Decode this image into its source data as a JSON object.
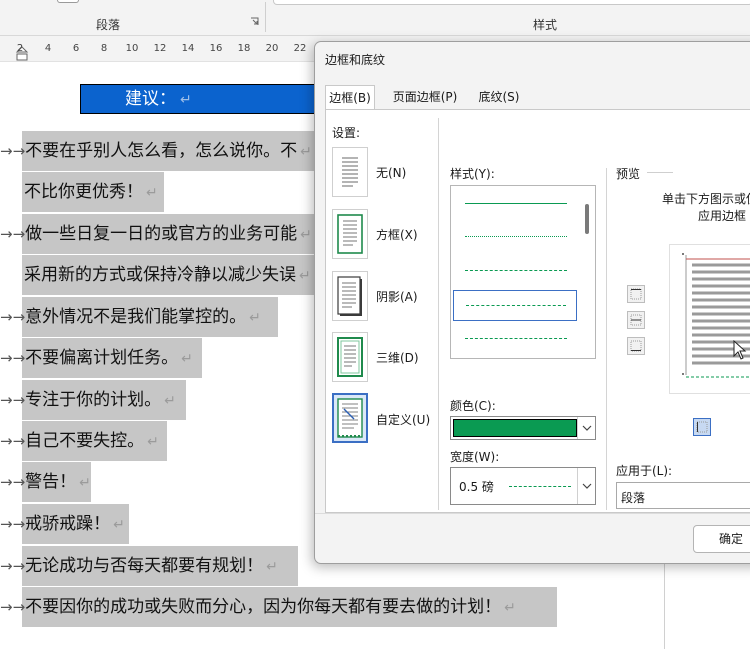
{
  "ribbon": {
    "paragraph_group": "段落",
    "styles_group": "样式"
  },
  "ruler": {
    "ticks": [
      "2",
      "4",
      "6",
      "8",
      "10",
      "12",
      "14",
      "16",
      "18",
      "20",
      "22"
    ]
  },
  "document": {
    "heading": "建议：",
    "mark": "↵",
    "bullet": "→→",
    "lines": [
      {
        "text": "不要在乎别人怎么看，怎么说你。不",
        "bullet": true
      },
      {
        "text": "不比你更优秀！",
        "bullet": false
      },
      {
        "text": "做一些日复一日的或官方的业务可能",
        "bullet": true
      },
      {
        "text": "采用新的方式或保持冷静以减少失误",
        "bullet": false
      },
      {
        "text": "意外情况不是我们能掌控的。",
        "bullet": true
      },
      {
        "text": "不要偏离计划任务。",
        "bullet": true
      },
      {
        "text": "专注于你的计划。",
        "bullet": true
      },
      {
        "text": "自己不要失控。",
        "bullet": true
      },
      {
        "text": "警告！",
        "bullet": true
      },
      {
        "text": "戒骄戒躁！",
        "bullet": true
      },
      {
        "text": "无论成功与否每天都要有规划！",
        "bullet": true
      },
      {
        "text": "不要因你的成功或失败而分心，因为你每天都有要去做的计划！",
        "bullet": true
      }
    ]
  },
  "dialog": {
    "title": "边框和底纹",
    "tabs": [
      {
        "label": "边框(B)",
        "active": true
      },
      {
        "label": "页面边框(P)",
        "active": false
      },
      {
        "label": "底纹(S)",
        "active": false
      }
    ],
    "settings_label": "设置:",
    "settings": [
      {
        "label": "无(N)",
        "selected": false
      },
      {
        "label": "方框(X)",
        "selected": false
      },
      {
        "label": "阴影(A)",
        "selected": false
      },
      {
        "label": "三维(D)",
        "selected": false
      },
      {
        "label": "自定义(U)",
        "selected": true
      }
    ],
    "style_label": "样式(Y):",
    "color_label": "颜色(C):",
    "color_value": "#0a9a52",
    "width_label": "宽度(W):",
    "width_value": "0.5 磅",
    "preview_label": "预览",
    "preview_hint_1": "单击下方图示或使",
    "preview_hint_2": "应用边框",
    "apply_label": "应用于(L):",
    "apply_value": "段落",
    "ok_label": "确定"
  }
}
